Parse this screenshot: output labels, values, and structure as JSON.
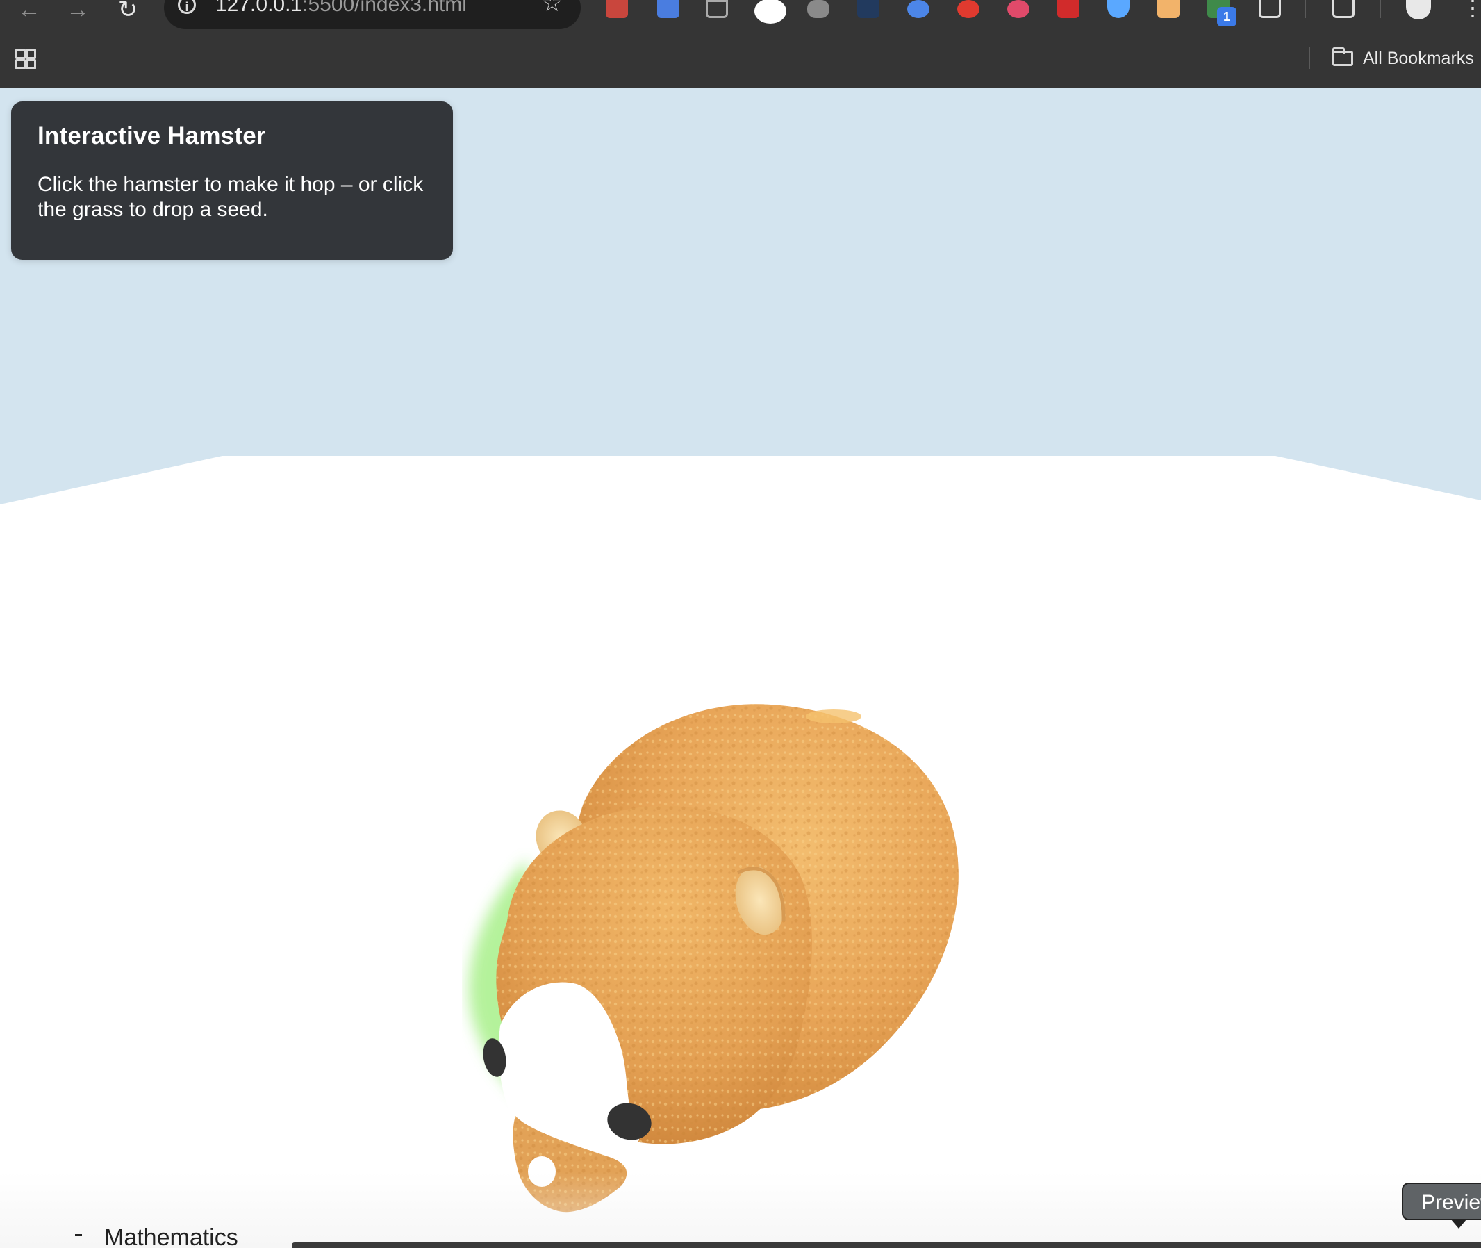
{
  "browser": {
    "url_host": "127.0.0.1",
    "url_rest": ":5500/index3.html",
    "bookmarks_label": "All Bookmarks",
    "extension_badge": "1"
  },
  "info_panel": {
    "title": "Interactive Hamster",
    "instructions": "Click the hamster to make it hop – or click the grass to drop a seed."
  },
  "scene": {
    "sky_color": "#d3e4ef",
    "ground_color": "#ffffff",
    "fur_color": "#e8a558",
    "ear_color": "#f6d9a0",
    "eye_color": "#333333",
    "seed_glow_color": "#a8f08a"
  },
  "footer": {
    "peek_text": "Mathematics",
    "tooltip": "Preview"
  }
}
